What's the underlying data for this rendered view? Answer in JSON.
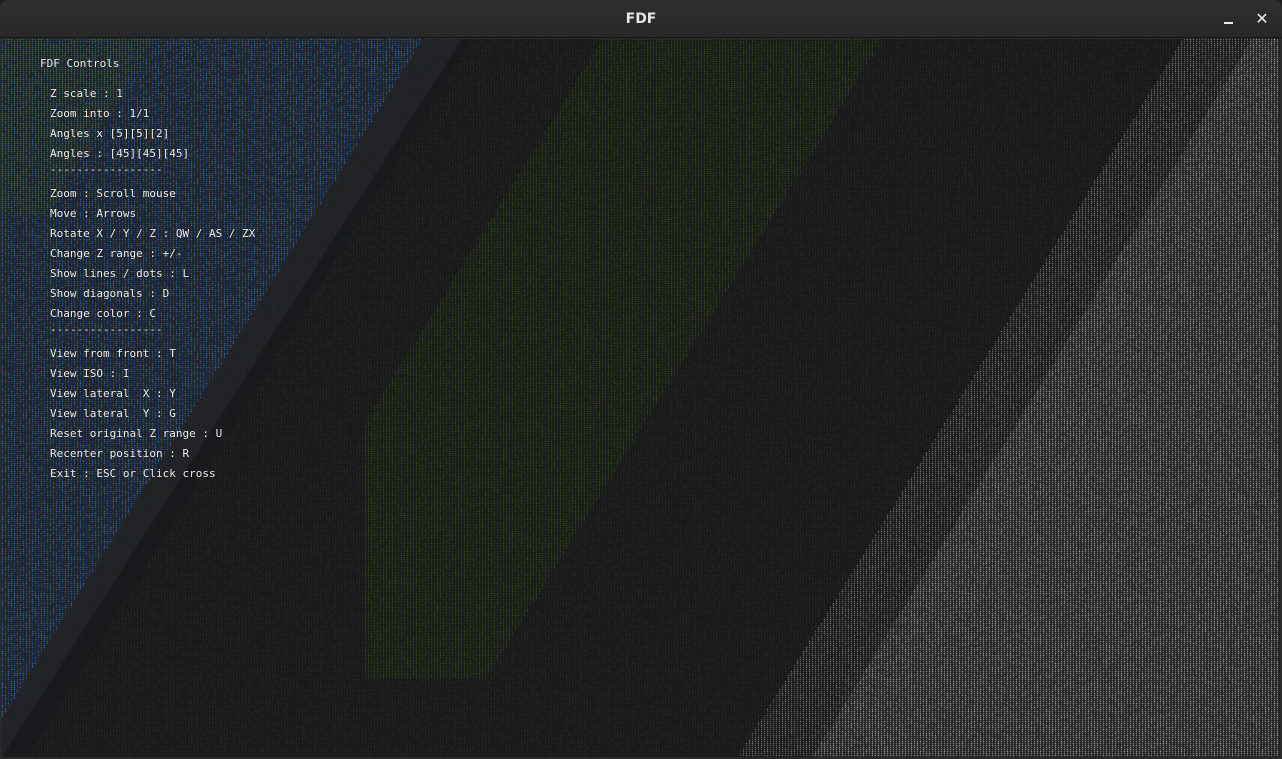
{
  "window": {
    "title": "FDF",
    "minimize_label": "–",
    "close_label": "✕"
  },
  "colors": {
    "blue": "#1565ff",
    "cyan": "#3aa0ff",
    "green": "#5fb830",
    "dark_bg": "#222222",
    "gray": "#8a8a8a",
    "white": "#ffffff"
  },
  "hud": {
    "heading": "FDF Controls",
    "status": [
      "Z scale : 1",
      "Zoom into : 1/1",
      "Angles x [5][5][2]",
      "Angles : [45][45][45]"
    ],
    "separator": "-----------------",
    "controls": [
      "Zoom : Scroll mouse",
      "Move : Arrows",
      "Rotate X / Y / Z : QW / AS / ZX",
      "Change Z range : +/-",
      "Show lines / dots : L",
      "Show diagonals : D",
      "Change color : C"
    ],
    "separator2": "-----------------",
    "views": [
      "View from front : T",
      "View ISO : I",
      "View lateral  X : Y",
      "View lateral  Y : G",
      "Reset original Z range : U",
      "Recenter position : R",
      "Exit : ESC or Click cross"
    ]
  }
}
